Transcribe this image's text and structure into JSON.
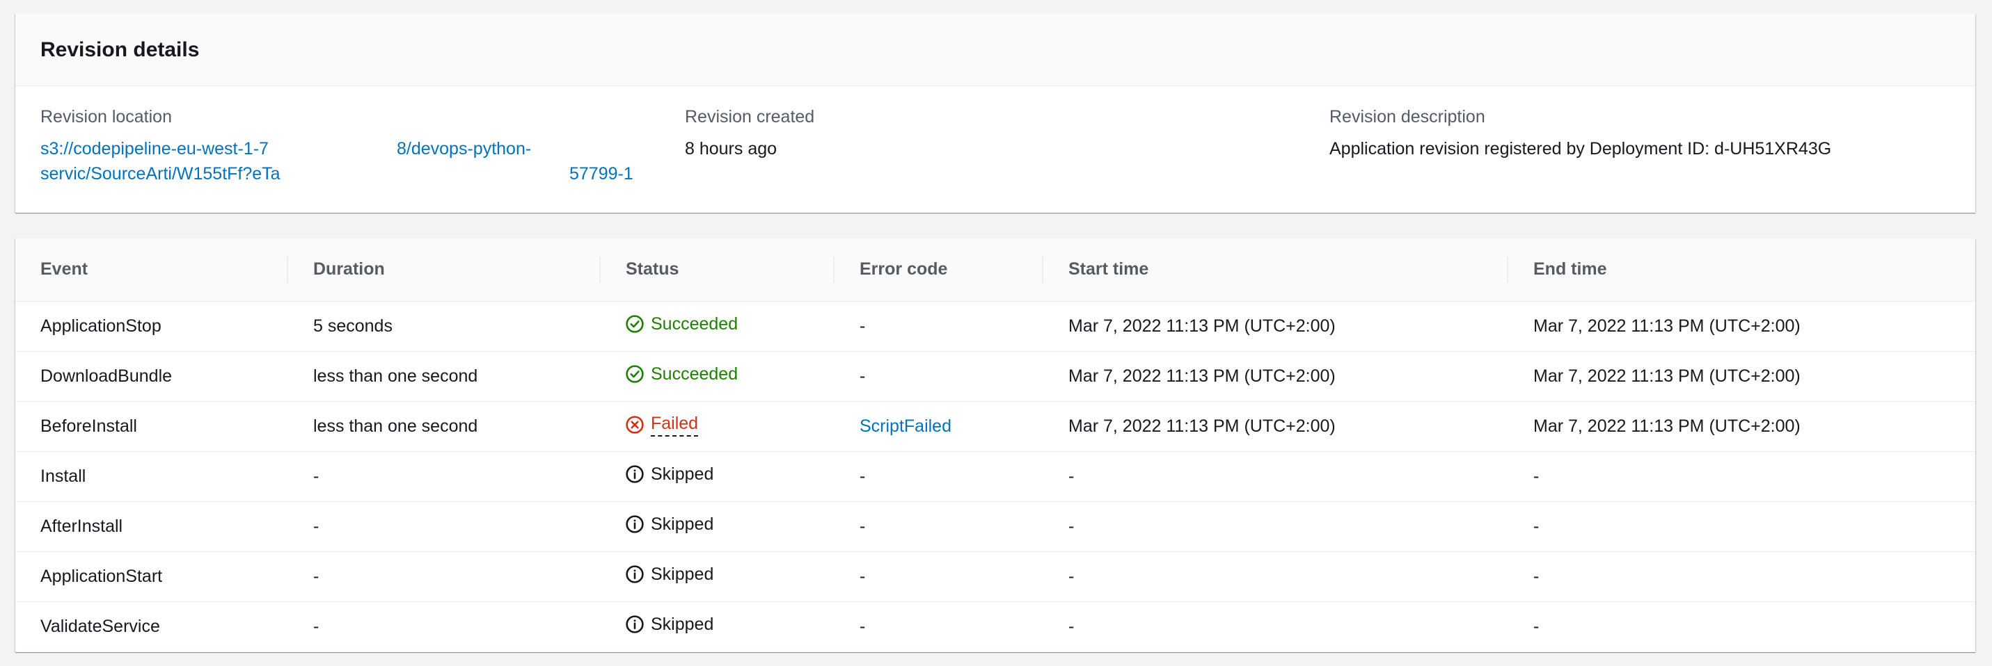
{
  "revision": {
    "title": "Revision details",
    "location_label": "Revision location",
    "location_line1": "s3://codepipeline-eu-west-1-7",
    "location_line1b": "8/devops-python-",
    "location_line2": "servic/SourceArti/W155tFf?eTa",
    "location_line2b": "57799-1",
    "created_label": "Revision created",
    "created_value": "8 hours ago",
    "description_label": "Revision description",
    "description_value": "Application revision registered by Deployment ID: d-UH51XR43G"
  },
  "events_table": {
    "columns": [
      "Event",
      "Duration",
      "Status",
      "Error code",
      "Start time",
      "End time"
    ],
    "rows": [
      {
        "event": "ApplicationStop",
        "duration": "5 seconds",
        "status": "Succeeded",
        "error_code": "-",
        "start": "Mar 7, 2022 11:13 PM (UTC+2:00)",
        "end": "Mar 7, 2022 11:13 PM (UTC+2:00)"
      },
      {
        "event": "DownloadBundle",
        "duration": "less than one second",
        "status": "Succeeded",
        "error_code": "-",
        "start": "Mar 7, 2022 11:13 PM (UTC+2:00)",
        "end": "Mar 7, 2022 11:13 PM (UTC+2:00)"
      },
      {
        "event": "BeforeInstall",
        "duration": "less than one second",
        "status": "Failed",
        "error_code": "ScriptFailed",
        "start": "Mar 7, 2022 11:13 PM (UTC+2:00)",
        "end": "Mar 7, 2022 11:13 PM (UTC+2:00)"
      },
      {
        "event": "Install",
        "duration": "-",
        "status": "Skipped",
        "error_code": "-",
        "start": "-",
        "end": "-"
      },
      {
        "event": "AfterInstall",
        "duration": "-",
        "status": "Skipped",
        "error_code": "-",
        "start": "-",
        "end": "-"
      },
      {
        "event": "ApplicationStart",
        "duration": "-",
        "status": "Skipped",
        "error_code": "-",
        "start": "-",
        "end": "-"
      },
      {
        "event": "ValidateService",
        "duration": "-",
        "status": "Skipped",
        "error_code": "-",
        "start": "-",
        "end": "-"
      }
    ]
  },
  "icons": {
    "Succeeded": "status-success-icon",
    "Failed": "status-failed-icon",
    "Skipped": "status-info-icon"
  },
  "colors": {
    "success": "#1d8102",
    "error": "#d13212",
    "link": "#0073bb"
  }
}
